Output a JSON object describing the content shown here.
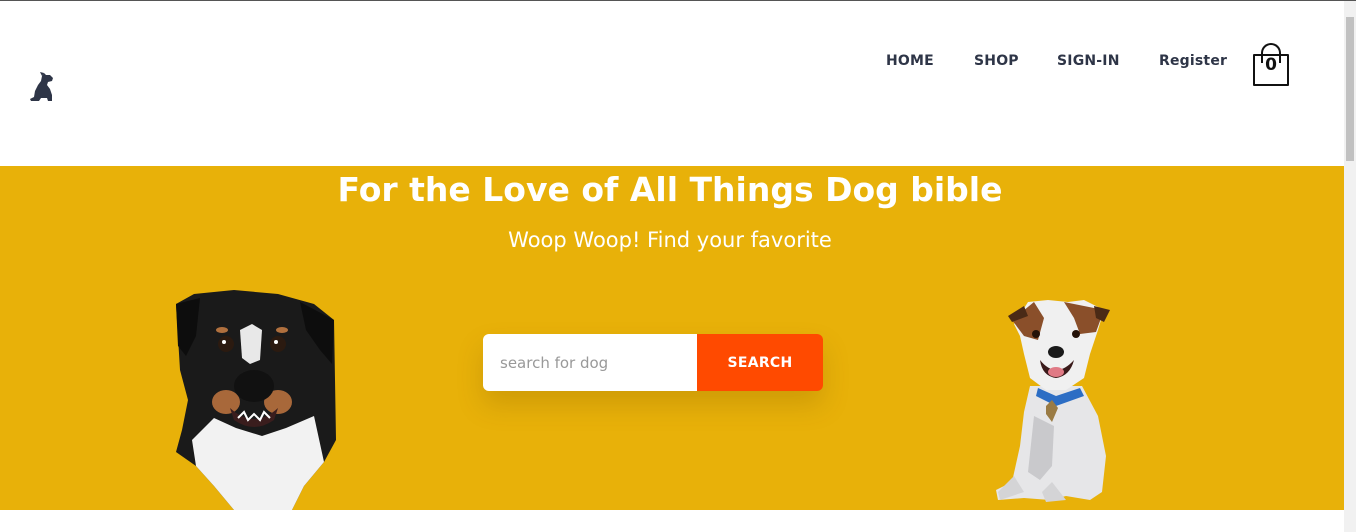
{
  "header": {
    "logo_icon": "dog-silhouette-icon",
    "nav": {
      "home": "HOME",
      "shop": "SHOP",
      "signin": "SIGN-IN",
      "register": "Register"
    },
    "cart": {
      "icon": "shopping-bag-icon",
      "count": "0"
    }
  },
  "hero": {
    "background_color": "#e8b109",
    "title": "For the Love of All Things Dog bible",
    "subtitle": "Woop Woop! Find your favorite",
    "search": {
      "placeholder": "search for dog",
      "value": "",
      "button_label": "SEARCH",
      "button_color": "#ff4a00"
    },
    "images": {
      "left": "black-and-white-dog-photo",
      "right": "jack-russell-terrier-photo"
    }
  }
}
